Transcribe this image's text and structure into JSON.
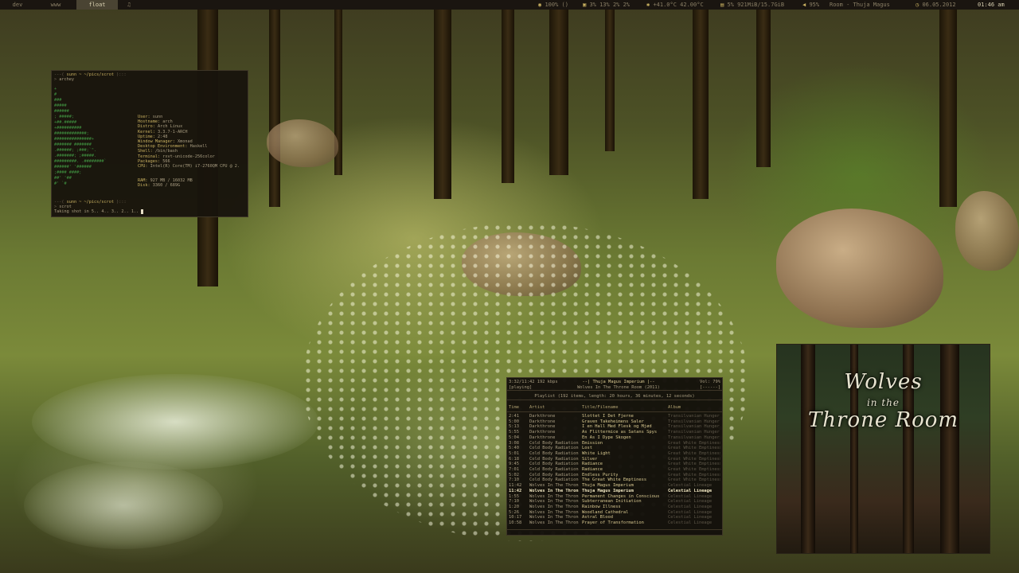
{
  "bar": {
    "workspaces": [
      {
        "label": "dev",
        "active": false
      },
      {
        "label": "www",
        "active": false
      },
      {
        "label": "float",
        "active": true
      },
      {
        "label": "♫",
        "active": false
      }
    ],
    "volume_text": "100% ()",
    "cpu_text": "3% 13% 2% 2%",
    "temp_text": "+41.0°C 42.00°C",
    "mem_text": "5% 921MiB/15.7GiB",
    "mpd_vol_text": "95%",
    "now_playing": "Room - Thuja Magus",
    "date_text": "06.05.2012",
    "time_text": "01:46 am",
    "icons": [
      "speaker-icon",
      "cpu-icon",
      "thermometer-icon",
      "memory-icon",
      "volume-icon",
      "clock-icon"
    ]
  },
  "terminal": {
    "prompt1": "sunn ~ ~/pics/scrot",
    "cmd1": "archey",
    "art": [
      "            +",
      "            #",
      "           ###",
      "          #####",
      "          ######",
      "         ; #####;",
      "        +##.#####",
      "       +##########",
      "      #############;",
      "     ###############+",
      "    #######   #######",
      "   .######;   ;###;`\".",
      "  .#######;   ;#####.",
      "  #########.   .########`",
      " ######'           '######",
      ";####                 ####;",
      "##'                     '##",
      "#'                       `#"
    ],
    "info": [
      {
        "k": "User:",
        "v": "sunn"
      },
      {
        "k": "Hostname:",
        "v": "arch"
      },
      {
        "k": "Distro:",
        "v": "Arch Linux"
      },
      {
        "k": "Kernel:",
        "v": "3.3.7-1-ARCH"
      },
      {
        "k": "Uptime:",
        "v": "2:48"
      },
      {
        "k": "Window Manager:",
        "v": "Xmonad"
      },
      {
        "k": "Desktop Environment:",
        "v": "Haskell"
      },
      {
        "k": "Shell:",
        "v": "/bin/bash"
      },
      {
        "k": "Terminal:",
        "v": "rxvt-unicode-256color"
      },
      {
        "k": "Packages:",
        "v": "566"
      },
      {
        "k": "CPU:",
        "v": "Intel(R) Core(TM) i7-2760QM CPU @ 2."
      },
      {
        "k": "RAM:",
        "v": "927 MB / 16032 MB"
      },
      {
        "k": "Disk:",
        "v": "3360 / 689G"
      }
    ],
    "prompt2": "sunn ~ ~/pics/scrot",
    "cmd2": "scrot",
    "output": "Taking shot in 5.. 4.. 3.. 2.. 1.. "
  },
  "ncmpcpp": {
    "time_bitrate": "3:32/11:42 192 kbps",
    "song_title": "Thuja Magus Imperium",
    "state": "[playing]",
    "album_line": "Wolves In The Throne Room (2011)",
    "volume": "Vol: 79%",
    "flags": "[------]",
    "playlist_header": "Playlist (192 items, length: 20 hours, 36 minutes, 12 seconds)",
    "columns": [
      "Time",
      "Artist",
      "Title/Filename",
      "Album"
    ],
    "rows": [
      {
        "time": "2:41",
        "artist": "Darkthrone",
        "title": "Slottet I Det Fjerne",
        "album": "Transilvanian Hunger",
        "current": false
      },
      {
        "time": "5:00",
        "artist": "Darkthrone",
        "title": "Graven Takeheimens Saler",
        "album": "Transilvanian Hunger",
        "current": false
      },
      {
        "time": "5:13",
        "artist": "Darkthrone",
        "title": "I en Hall Med Flesk og Mjød",
        "album": "Transilvanian Hunger",
        "current": false
      },
      {
        "time": "5:55",
        "artist": "Darkthrone",
        "title": "As Flittermice as Satans Spys",
        "album": "Transilvanian Hunger",
        "current": false
      },
      {
        "time": "5:04",
        "artist": "Darkthrone",
        "title": "En As I Dype Skogen",
        "album": "Transilvanian Hunger",
        "current": false
      },
      {
        "time": "3:08",
        "artist": "Cold Body Radiation",
        "title": "Emission",
        "album": "Great White Emptiness",
        "current": false
      },
      {
        "time": "5:40",
        "artist": "Cold Body Radiation",
        "title": "Lost",
        "album": "Great White Emptiness",
        "current": false
      },
      {
        "time": "5:01",
        "artist": "Cold Body Radiation",
        "title": "White Light",
        "album": "Great White Emptiness",
        "current": false
      },
      {
        "time": "6:18",
        "artist": "Cold Body Radiation",
        "title": "Silver",
        "album": "Great White Emptiness",
        "current": false
      },
      {
        "time": "9:45",
        "artist": "Cold Body Radiation",
        "title": "Radiance",
        "album": "Great White Emptiness",
        "current": false
      },
      {
        "time": "7:01",
        "artist": "Cold Body Radiation",
        "title": "Radiance",
        "album": "Great White Emptiness",
        "current": false
      },
      {
        "time": "5:02",
        "artist": "Cold Body Radiation",
        "title": "Endless Purity",
        "album": "Great White Emptiness",
        "current": false
      },
      {
        "time": "7:10",
        "artist": "Cold Body Radiation",
        "title": "The Great White Emptiness",
        "album": "Great White Emptiness",
        "current": false
      },
      {
        "time": "11:42",
        "artist": "Wolves In The Thron",
        "title": "Thuja Magus Imperium",
        "album": "Celestial Lineage",
        "current": false
      },
      {
        "time": "11:42",
        "artist": "Wolves In The Thron",
        "title": "Thuja Magus Imperium",
        "album": "Celestial Lineage",
        "current": true
      },
      {
        "time": "1:55",
        "artist": "Wolves In The Thron",
        "title": "Permanent Changes in Conscious",
        "album": "Celestial Lineage",
        "current": false
      },
      {
        "time": "7:10",
        "artist": "Wolves In The Thron",
        "title": "Subterranean Initiation",
        "album": "Celestial Lineage",
        "current": false
      },
      {
        "time": "1:20",
        "artist": "Wolves In The Thron",
        "title": "Rainbow Illness",
        "album": "Celestial Lineage",
        "current": false
      },
      {
        "time": "5:26",
        "artist": "Wolves In The Thron",
        "title": "Woodland Cathedral",
        "album": "Celestial Lineage",
        "current": false
      },
      {
        "time": "10:17",
        "artist": "Wolves In The Thron",
        "title": "Astral Blood",
        "album": "Celestial Lineage",
        "current": false
      },
      {
        "time": "10:58",
        "artist": "Wolves In The Thron",
        "title": "Prayer of Transformation",
        "album": "Celestial Lineage",
        "current": false
      }
    ]
  },
  "cover": {
    "logo_line1": "Wolves",
    "logo_line2": "in the",
    "logo_line3": "Throne Room"
  }
}
